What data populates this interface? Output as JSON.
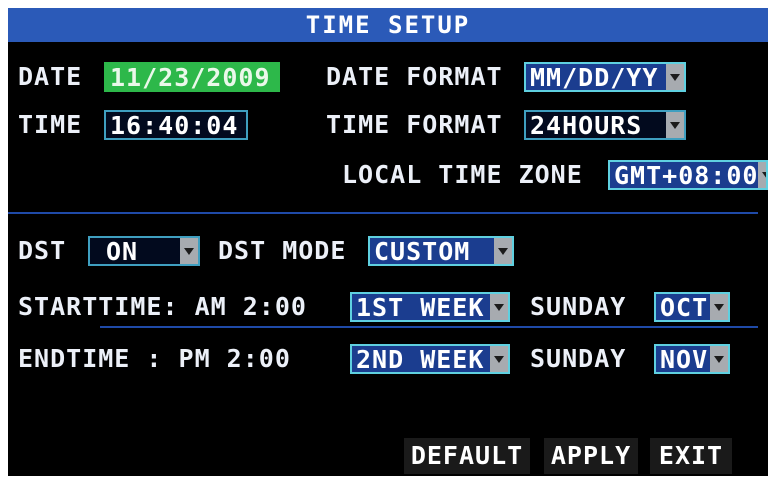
{
  "window": {
    "title": "TIME SETUP"
  },
  "date": {
    "label": "DATE",
    "value": "11/23/2009"
  },
  "date_format": {
    "label": "DATE FORMAT",
    "value": "MM/DD/YY"
  },
  "time": {
    "label": "TIME",
    "value": "16:40:04"
  },
  "time_format": {
    "label": "TIME FORMAT",
    "value": "24HOURS"
  },
  "time_zone": {
    "label": "LOCAL TIME ZONE",
    "value": "GMT+08:00"
  },
  "dst": {
    "label": "DST",
    "value": "ON"
  },
  "dst_mode": {
    "label": "DST MODE",
    "value": "CUSTOM"
  },
  "start": {
    "label": "STARTTIME: AM 2:00",
    "week": "1ST WEEK",
    "day": "SUNDAY",
    "month": "OCT"
  },
  "end": {
    "label": "ENDTIME  : PM 2:00",
    "week": "2ND WEEK",
    "day": "SUNDAY",
    "month": "NOV"
  },
  "buttons": {
    "default": "DEFAULT",
    "apply": "APPLY",
    "exit": "EXIT"
  },
  "icons": {
    "dropdown": "chevron-down-icon"
  },
  "colors": {
    "title_bar": "#2b5ab8",
    "active_field": "#2db84a",
    "field_border": "#3f9fc0",
    "background": "#000000"
  }
}
